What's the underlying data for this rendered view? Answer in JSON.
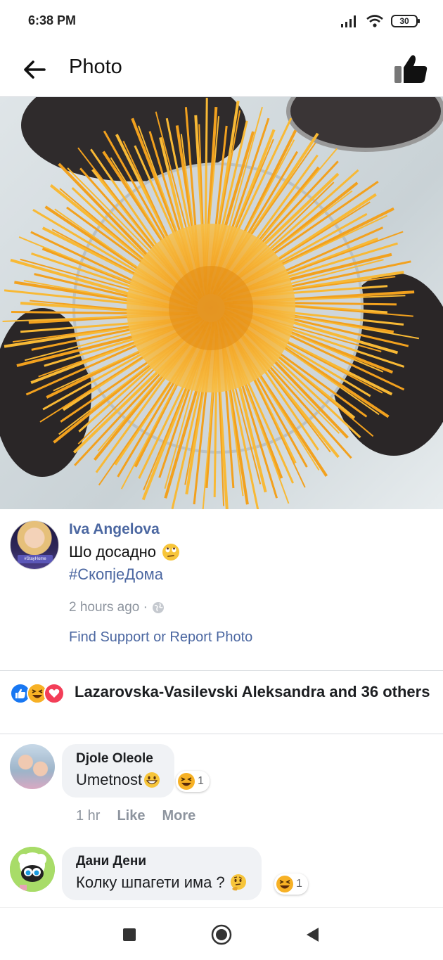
{
  "status_bar": {
    "time": "6:38 PM",
    "battery": "30"
  },
  "app_bar": {
    "title": "Photo"
  },
  "post": {
    "author": "Iva Angelova",
    "avatar_tag": "#StayHome",
    "caption": "Шо досадно",
    "hashtag": "#СкопјеДома",
    "time": "2 hours ago ·",
    "find_support": "Find Support or Report Photo"
  },
  "reactions": {
    "icons": [
      "like-icon",
      "haha-icon",
      "love-icon"
    ],
    "text": "Lazarovska-Vasilevski Aleksandra and 36 others"
  },
  "comments": [
    {
      "name": "Djole Oleole",
      "text": "Umetnost",
      "reaction_count": "1",
      "time": "1 hr",
      "like": "Like",
      "more": "More"
    },
    {
      "name": "Дани Дени",
      "text": "Колку шпагети има ?",
      "reaction_count": "1"
    }
  ],
  "colors": {
    "link": "#4b67a1",
    "like_blue": "#1877f2",
    "love_red": "#f33e58",
    "haha_yellow": "#f7b125",
    "pasta": "#f5a623"
  }
}
